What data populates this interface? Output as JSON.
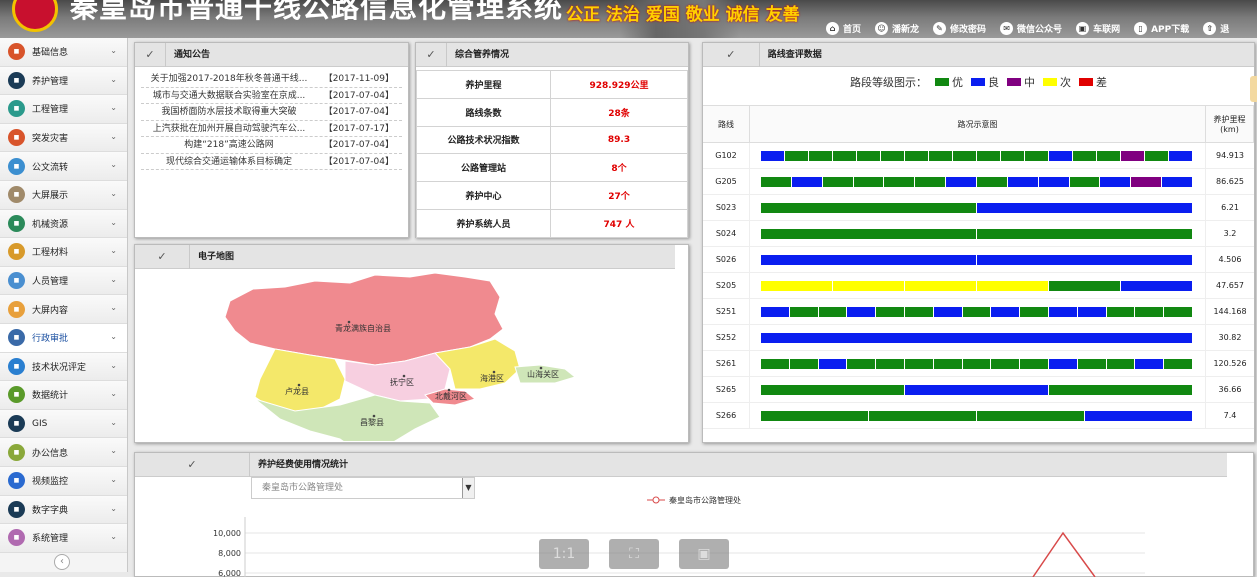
{
  "header": {
    "title": "秦皇岛市普通干线公路信息化管理系统",
    "slogan": "公正 法治 爱国 敬业 诚信 友善",
    "nav": [
      {
        "label": "首页",
        "icon": "home-icon"
      },
      {
        "label": "潘新龙",
        "icon": "user-icon"
      },
      {
        "label": "修改密码",
        "icon": "key-icon"
      },
      {
        "label": "微信公众号",
        "icon": "wechat-icon"
      },
      {
        "label": "车联网",
        "icon": "car-icon"
      },
      {
        "label": "APP下载",
        "icon": "phone-icon"
      },
      {
        "label": "退",
        "icon": "exit-icon"
      }
    ]
  },
  "sidebar": {
    "items": [
      {
        "label": "基础信息",
        "icon": "database-icon",
        "color": "#d8542b"
      },
      {
        "label": "养护管理",
        "icon": "maintenance-icon",
        "color": "#1b3b56"
      },
      {
        "label": "工程管理",
        "icon": "project-icon",
        "color": "#2b9a8c"
      },
      {
        "label": "突发灾害",
        "icon": "alert-icon",
        "color": "#d8542b"
      },
      {
        "label": "公文流转",
        "icon": "globe-icon",
        "color": "#3c8fd0"
      },
      {
        "label": "大屏展示",
        "icon": "screen-icon",
        "color": "#a08a6a"
      },
      {
        "label": "机械资源",
        "icon": "machine-icon",
        "color": "#2b8a5a"
      },
      {
        "label": "工程材料",
        "icon": "material-icon",
        "color": "#d89a2b"
      },
      {
        "label": "人员管理",
        "icon": "people-icon",
        "color": "#4a8fd0"
      },
      {
        "label": "大屏内容",
        "icon": "content-icon",
        "color": "#e8a03c"
      },
      {
        "label": "行政审批",
        "icon": "approval-icon",
        "color": "#3a6aa8",
        "active": true
      },
      {
        "label": "技术状况评定",
        "icon": "tech-icon",
        "color": "#2a7fd0"
      },
      {
        "label": "数据统计",
        "icon": "stats-icon",
        "color": "#5a9a2a"
      },
      {
        "label": "GIS",
        "icon": "gis-icon",
        "color": "#1b3b56"
      },
      {
        "label": "办公信息",
        "icon": "office-icon",
        "color": "#8aa83a"
      },
      {
        "label": "视频监控",
        "icon": "camera-icon",
        "color": "#2a6ad0"
      },
      {
        "label": "数字字典",
        "icon": "dictionary-icon",
        "color": "#1b3b56"
      },
      {
        "label": "系统管理",
        "icon": "settings-icon",
        "color": "#b06ab0"
      }
    ]
  },
  "notice": {
    "title": "通知公告",
    "items": [
      {
        "text": "关于加强2017-2018年秋冬普通干线...",
        "date": "【2017-11-09】"
      },
      {
        "text": "城市与交通大数据联合实验室在京成...",
        "date": "【2017-07-04】"
      },
      {
        "text": "我国桥面防水层技术取得重大突破",
        "date": "【2017-07-04】"
      },
      {
        "text": "上汽获批在加州开展自动驾驶汽车公...",
        "date": "【2017-07-17】"
      },
      {
        "text": "构建“218”高速公路网",
        "date": "【2017-07-04】"
      },
      {
        "text": "现代综合交通运输体系目标确定",
        "date": "【2017-07-04】"
      }
    ]
  },
  "summary": {
    "title": "综合管养情况",
    "rows": [
      {
        "key": "养护里程",
        "value": "928.929公里"
      },
      {
        "key": "路线条数",
        "value": "28条"
      },
      {
        "key": "公路技术状况指数",
        "value": "89.3"
      },
      {
        "key": "公路管理站",
        "value": "8个"
      },
      {
        "key": "养护中心",
        "value": "27个"
      },
      {
        "key": "养护系统人员",
        "value": "747 人"
      }
    ]
  },
  "map": {
    "title": "电子地图",
    "regions": [
      "青龙满族自治县",
      "卢龙县",
      "抚宁区",
      "海港区",
      "山海关区",
      "北戴河区",
      "昌黎县"
    ]
  },
  "roads": {
    "title": "路线查评数据",
    "legend_title": "路段等级图示：",
    "legend": [
      {
        "label": "优",
        "color": "#118811"
      },
      {
        "label": "良",
        "color": "#0a1ef0"
      },
      {
        "label": "中",
        "color": "#800080"
      },
      {
        "label": "次",
        "color": "#ffff00"
      },
      {
        "label": "差",
        "color": "#e00000"
      }
    ],
    "columns": [
      "路线",
      "路况示意图",
      "养护里程(km)"
    ],
    "rows": [
      {
        "name": "G102",
        "length": "94.913",
        "segments": [
          "b",
          "g",
          "g",
          "g",
          "g",
          "g",
          "g",
          "g",
          "g",
          "g",
          "g",
          "g",
          "b",
          "g",
          "g",
          "p",
          "g",
          "b"
        ]
      },
      {
        "name": "G205",
        "length": "86.625",
        "segments": [
          "g",
          "b",
          "g",
          "g",
          "g",
          "g",
          "b",
          "g",
          "b",
          "b",
          "g",
          "b",
          "p",
          "b"
        ]
      },
      {
        "name": "S023",
        "length": "6.21",
        "segments": [
          "g",
          "b"
        ]
      },
      {
        "name": "S024",
        "length": "3.2",
        "segments": [
          "g",
          "g"
        ]
      },
      {
        "name": "S026",
        "length": "4.506",
        "segments": [
          "b",
          "b"
        ]
      },
      {
        "name": "S205",
        "length": "47.657",
        "segments": [
          "y",
          "y",
          "y",
          "y",
          "g",
          "b"
        ]
      },
      {
        "name": "S251",
        "length": "144.168",
        "segments": [
          "b",
          "g",
          "g",
          "b",
          "g",
          "g",
          "b",
          "g",
          "b",
          "g",
          "b",
          "b",
          "g",
          "g",
          "g"
        ]
      },
      {
        "name": "S252",
        "length": "30.82",
        "segments": [
          "b"
        ]
      },
      {
        "name": "S261",
        "length": "120.526",
        "segments": [
          "g",
          "g",
          "b",
          "g",
          "g",
          "g",
          "g",
          "g",
          "g",
          "g",
          "b",
          "g",
          "g",
          "b",
          "g"
        ]
      },
      {
        "name": "S265",
        "length": "36.66",
        "segments": [
          "g",
          "b",
          "g"
        ]
      },
      {
        "name": "S266",
        "length": "7.4",
        "segments": [
          "g",
          "g",
          "g",
          "b"
        ]
      }
    ]
  },
  "expense": {
    "title": "养护经费使用情况统计",
    "select_value": "秦皇岛市公路管理处",
    "legend": "秦皇岛市公路管理处",
    "y_ticks": [
      "10,000",
      "8,000",
      "6,000"
    ]
  },
  "viewer": {
    "buttons": [
      "1:1",
      "⛶",
      "▣"
    ]
  }
}
